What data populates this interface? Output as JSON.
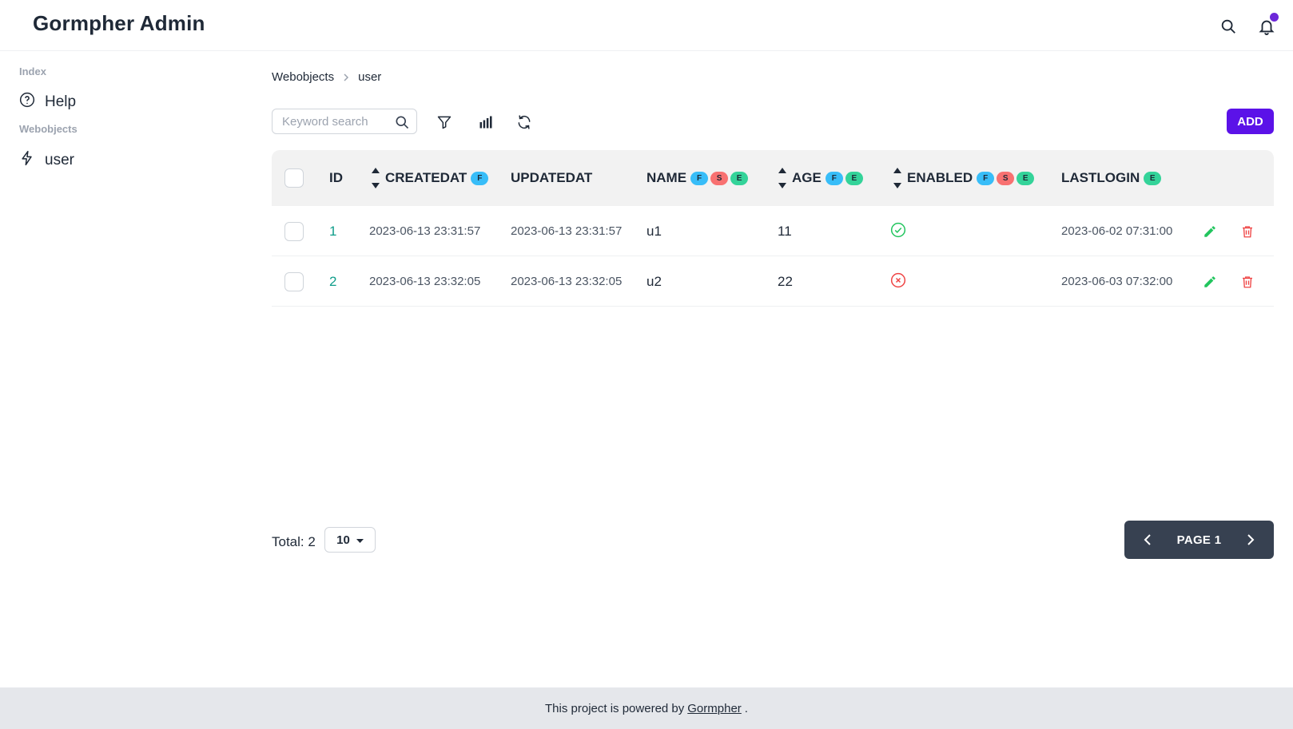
{
  "app": {
    "title": "Gormpher Admin"
  },
  "header": {
    "search_icon": "search-icon",
    "bell_icon": "bell-icon",
    "notification_color": "#6d28d9"
  },
  "sidebar": {
    "sections": [
      {
        "label": "Index",
        "items": [
          {
            "label": "Help",
            "icon": "help-circle-icon"
          }
        ]
      },
      {
        "label": "Webobjects",
        "items": [
          {
            "label": "user",
            "icon": "lightning-icon"
          }
        ]
      }
    ]
  },
  "breadcrumb": {
    "items": [
      "Webobjects",
      "user"
    ],
    "separator": ">"
  },
  "toolbar": {
    "search_placeholder": "Keyword search",
    "add_label": "ADD",
    "accent": "#5b12e8"
  },
  "table": {
    "columns": [
      {
        "key": "id",
        "label": "ID",
        "sortable": false,
        "badges": []
      },
      {
        "key": "createdat",
        "label": "CREATEDAT",
        "sortable": true,
        "badges": [
          "F"
        ]
      },
      {
        "key": "updatedat",
        "label": "UPDATEDAT",
        "sortable": false,
        "badges": []
      },
      {
        "key": "name",
        "label": "NAME",
        "sortable": false,
        "badges": [
          "F",
          "S",
          "E"
        ]
      },
      {
        "key": "age",
        "label": "AGE",
        "sortable": true,
        "badges": [
          "F",
          "E"
        ]
      },
      {
        "key": "enabled",
        "label": "ENABLED",
        "sortable": true,
        "badges": [
          "F",
          "S",
          "E"
        ]
      },
      {
        "key": "lastlogin",
        "label": "LASTLOGIN",
        "sortable": false,
        "badges": [
          "E"
        ]
      }
    ],
    "rows": [
      {
        "id": "1",
        "createdat": "2023-06-13 23:31:57",
        "updatedat": "2023-06-13 23:31:57",
        "name": "u1",
        "age": "11",
        "enabled": true,
        "lastlogin": "2023-06-02 07:31:00"
      },
      {
        "id": "2",
        "createdat": "2023-06-13 23:32:05",
        "updatedat": "2023-06-13 23:32:05",
        "name": "u2",
        "age": "22",
        "enabled": false,
        "lastlogin": "2023-06-03 07:32:00"
      }
    ],
    "enabled_true_color": "#22c55e",
    "enabled_false_color": "#ef4444"
  },
  "pagination": {
    "total_label": "Total: 2",
    "page_size": "10",
    "page_label": "PAGE 1"
  },
  "footer": {
    "text_before": "This project is powered by",
    "link": "Gormpher",
    "text_after": "."
  }
}
